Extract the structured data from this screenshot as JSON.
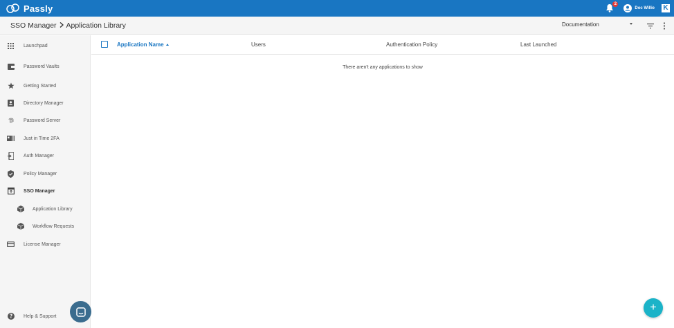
{
  "app": {
    "brand": "Passly",
    "user_name": "Doc Willie",
    "notification_count": "2",
    "k_label": "K"
  },
  "header": {
    "breadcrumb": [
      "SSO Manager",
      "Application Library"
    ],
    "documentation_label": "Documentation"
  },
  "sidebar": {
    "items": [
      {
        "label": "Launchpad",
        "icon": "grid-icon"
      },
      {
        "label": "Password Vaults",
        "icon": "wallet-icon"
      },
      {
        "label": "Getting Started",
        "icon": "star-icon"
      },
      {
        "label": "Directory Manager",
        "icon": "contact-card-icon"
      },
      {
        "label": "Password Server",
        "icon": "fingerprint-icon"
      },
      {
        "label": "Just in Time 2FA",
        "icon": "id-badge-icon"
      },
      {
        "label": "Auth Manager",
        "icon": "phone-login-icon"
      },
      {
        "label": "Policy Manager",
        "icon": "shield-check-icon"
      },
      {
        "label": "SSO Manager",
        "icon": "window-icon"
      },
      {
        "label": "Application Library",
        "icon": "cube-icon"
      },
      {
        "label": "Workflow Requests",
        "icon": "cube-icon"
      },
      {
        "label": "License Manager",
        "icon": "credit-card-icon"
      }
    ],
    "help_label": "Help & Support"
  },
  "table": {
    "columns": [
      "Application Name",
      "Users",
      "Authentication Policy",
      "Last Launched"
    ],
    "empty_message": "There aren't any applications to show"
  },
  "fab_label": "+",
  "colors": {
    "primary": "#1976c2",
    "fab": "#1bb3c8",
    "chat": "#3a6c8e"
  }
}
